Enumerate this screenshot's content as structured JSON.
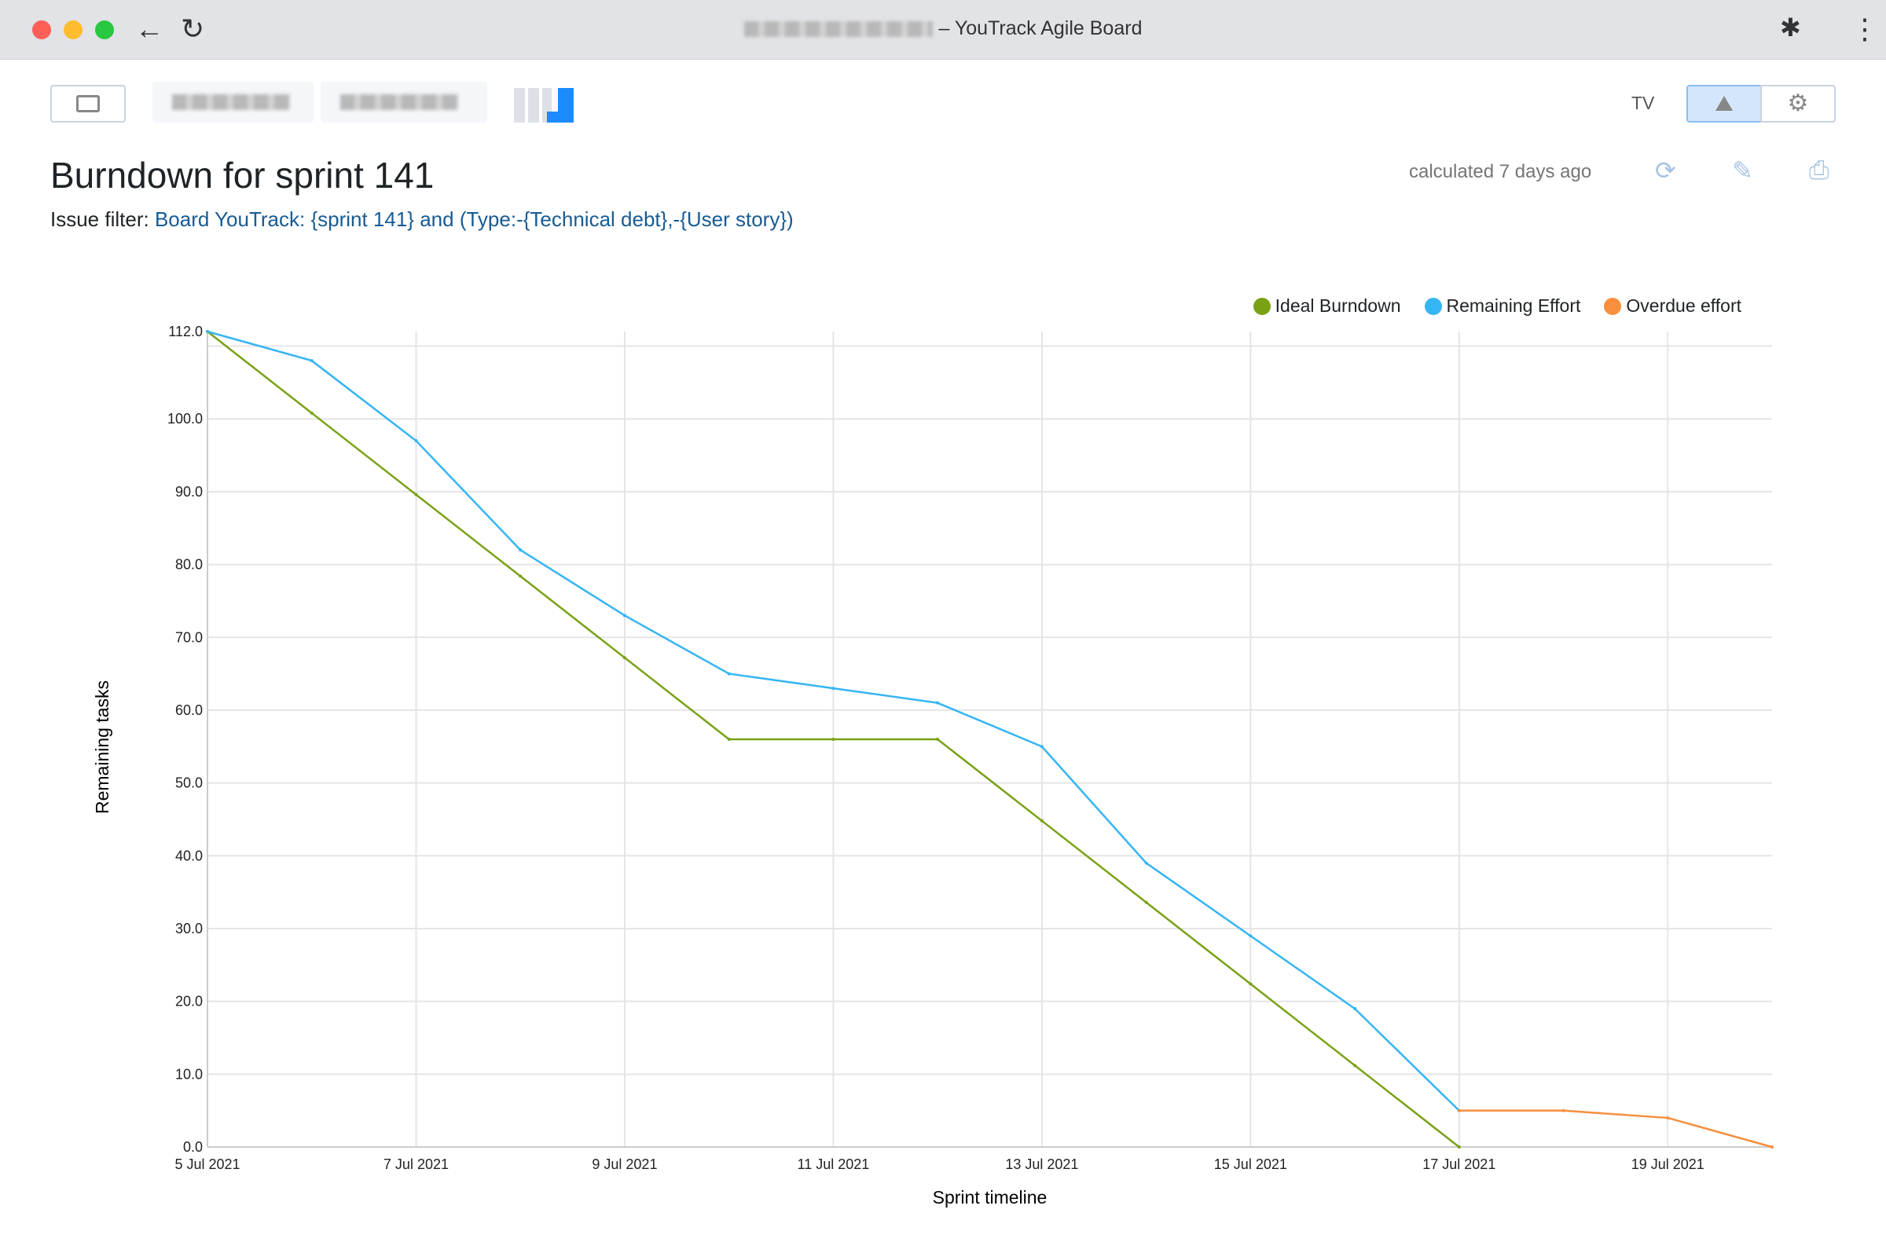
{
  "window": {
    "title_suffix": "– YouTrack Agile Board"
  },
  "toolbar": {
    "tv_label": "TV"
  },
  "header": {
    "title": "Burndown for sprint 141",
    "filter_label": "Issue filter:",
    "filter_query": "Board YouTrack: {sprint 141} and (Type:-{Technical debt},-{User story})",
    "calculated": "calculated 7 days ago"
  },
  "icons": {
    "refresh": "refresh-icon",
    "edit": "pencil-icon",
    "print": "printer-icon",
    "chart": "chart-icon",
    "settings": "gear-icon"
  },
  "chart_data": {
    "type": "line",
    "xlabel": "Sprint timeline",
    "ylabel": "Remaining tasks",
    "ylim": [
      0,
      112
    ],
    "yticks": [
      "0.0",
      "10.0",
      "20.0",
      "30.0",
      "40.0",
      "50.0",
      "60.0",
      "70.0",
      "80.0",
      "90.0",
      "100.0",
      "112.0"
    ],
    "ytick_values": [
      0,
      10,
      20,
      30,
      40,
      50,
      60,
      70,
      80,
      90,
      100,
      112
    ],
    "x": [
      "5 Jul 2021",
      "6 Jul 2021",
      "7 Jul 2021",
      "8 Jul 2021",
      "9 Jul 2021",
      "10 Jul 2021",
      "11 Jul 2021",
      "12 Jul 2021",
      "13 Jul 2021",
      "14 Jul 2021",
      "15 Jul 2021",
      "16 Jul 2021",
      "17 Jul 2021",
      "18 Jul 2021",
      "19 Jul 2021",
      "20 Jul 2021"
    ],
    "xtick_labels": [
      "5 Jul 2021",
      "7 Jul 2021",
      "9 Jul 2021",
      "11 Jul 2021",
      "13 Jul 2021",
      "15 Jul 2021",
      "17 Jul 2021",
      "19 Jul 2021"
    ],
    "grid": true,
    "legend_position": "top-right",
    "series": [
      {
        "name": "Ideal Burndown",
        "color": "#7aa116",
        "values": [
          112,
          100.8,
          89.6,
          78.4,
          67.2,
          56,
          56,
          56,
          44.8,
          33.6,
          22.4,
          11.2,
          0,
          null,
          null,
          null
        ]
      },
      {
        "name": "Remaining Effort",
        "color": "#35b5f4",
        "values": [
          112,
          108,
          97,
          82,
          73,
          65,
          63,
          61,
          55,
          39,
          29,
          19,
          5,
          null,
          null,
          null
        ]
      },
      {
        "name": "Overdue effort",
        "color": "#f78f3d",
        "values": [
          null,
          null,
          null,
          null,
          null,
          null,
          null,
          null,
          null,
          null,
          null,
          null,
          5,
          5,
          4,
          0
        ]
      }
    ]
  }
}
